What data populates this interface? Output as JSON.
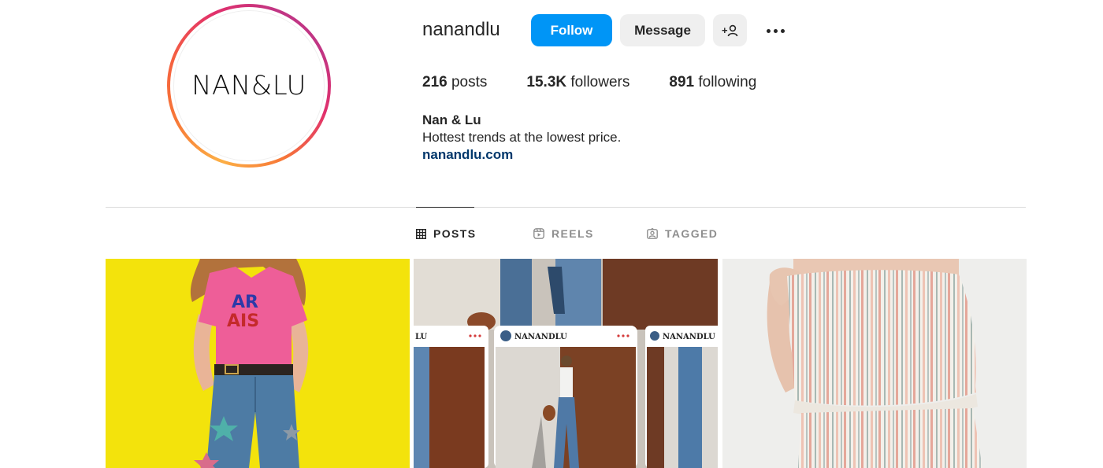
{
  "profile": {
    "avatar_text": "NAN&LU",
    "username": "nanandlu",
    "follow_label": "Follow",
    "message_label": "Message",
    "add_icon_text": "+",
    "stats": {
      "posts_count": "216",
      "posts_label": "posts",
      "followers_count": "15.3K",
      "followers_label": "followers",
      "following_count": "891",
      "following_label": "following"
    },
    "bio": {
      "name": "Nan & Lu",
      "text": "Hottest trends at the lowest price.",
      "link": "nanandlu.com"
    }
  },
  "tabs": [
    {
      "label": "POSTS",
      "icon": "grid-icon",
      "active": true
    },
    {
      "label": "REELS",
      "icon": "reels-icon",
      "active": false
    },
    {
      "label": "TAGGED",
      "icon": "tagged-icon",
      "active": false
    }
  ],
  "posts": {
    "post_2_handles": [
      "LU",
      "NANANDLU",
      "NANANDLU"
    ]
  },
  "colors": {
    "follow_button": "#0095f6",
    "secondary_button": "#efefef",
    "link": "#00376b",
    "text": "#262626",
    "muted": "#8e8e8e"
  }
}
